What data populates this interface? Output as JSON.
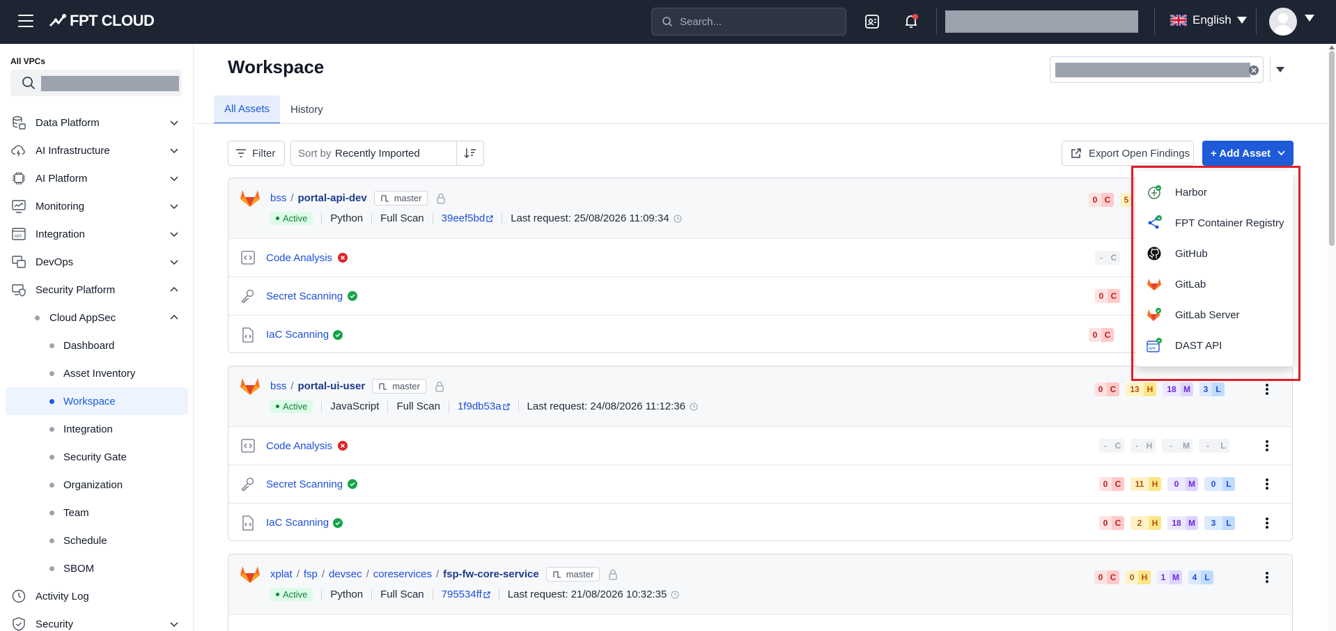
{
  "topbar": {
    "brand": "FPT CLOUD",
    "search_placeholder": "Search...",
    "language": "English"
  },
  "sidebar": {
    "vpc_label": "All VPCs",
    "items": [
      {
        "label": "Data Platform",
        "icon": "database-icon"
      },
      {
        "label": "AI Infrastructure",
        "icon": "cloud-bolt-icon"
      },
      {
        "label": "AI Platform",
        "icon": "chip-icon"
      },
      {
        "label": "Monitoring",
        "icon": "monitor-chart-icon"
      },
      {
        "label": "Integration",
        "icon": "api-icon"
      },
      {
        "label": "DevOps",
        "icon": "devops-icon"
      },
      {
        "label": "Security Platform",
        "icon": "security-platform-icon"
      }
    ],
    "cloud_appsec": "Cloud AppSec",
    "sub_items": [
      "Dashboard",
      "Asset Inventory",
      "Workspace",
      "Integration",
      "Security Gate",
      "Organization",
      "Team",
      "Schedule",
      "SBOM"
    ],
    "bottom_items": [
      "Activity Log",
      "Security"
    ]
  },
  "page": {
    "title": "Workspace",
    "tabs": [
      "All Assets",
      "History"
    ],
    "filter": "Filter",
    "sort_label": "Sort by",
    "sort_value": "Recently Imported",
    "export": "Export Open Findings",
    "add_asset": "+ Add Asset"
  },
  "assets": [
    {
      "path": [
        "bss"
      ],
      "repo": "portal-api-dev",
      "branch": "master",
      "status": "Active",
      "language": "Python",
      "scan_type": "Full Scan",
      "commit": "39eef5bd",
      "last_request": "Last request: 25/08/2026 11:09:34",
      "head_counts": {
        "c": "0",
        "h": "5"
      },
      "scans": [
        {
          "name": "Code Analysis",
          "status": "error",
          "c": "-"
        },
        {
          "name": "Secret Scanning",
          "status": "ok",
          "c": "0"
        },
        {
          "name": "IaC Scanning",
          "status": "ok",
          "c": "0"
        }
      ]
    },
    {
      "path": [
        "bss"
      ],
      "repo": "portal-ui-user",
      "branch": "master",
      "status": "Active",
      "language": "JavaScript",
      "scan_type": "Full Scan",
      "commit": "1f9db53a",
      "last_request": "Last request: 24/08/2026 11:12:36",
      "head_counts": {
        "c": "0",
        "h": "13",
        "m": "18",
        "l": "3"
      },
      "scans": [
        {
          "name": "Code Analysis",
          "status": "error",
          "c": "-",
          "h": "-",
          "m": "-",
          "l": "-"
        },
        {
          "name": "Secret Scanning",
          "status": "ok",
          "c": "0",
          "h": "11",
          "m": "0",
          "l": "0"
        },
        {
          "name": "IaC Scanning",
          "status": "ok",
          "c": "0",
          "h": "2",
          "m": "18",
          "l": "3"
        }
      ]
    },
    {
      "path": [
        "xplat",
        "fsp",
        "devsec",
        "coreservices"
      ],
      "repo": "fsp-fw-core-service",
      "branch": "master",
      "status": "Active",
      "language": "Python",
      "scan_type": "Full Scan",
      "commit": "795534ff",
      "last_request": "Last request: 21/08/2026 10:32:35",
      "head_counts": {
        "c": "0",
        "h": "0",
        "m": "1",
        "l": "4"
      }
    }
  ],
  "severity_letters": {
    "c": "C",
    "h": "H",
    "m": "M",
    "l": "L"
  },
  "path_separator": "/",
  "add_asset_menu": [
    "Harbor",
    "FPT Container Registry",
    "GitHub",
    "GitLab",
    "GitLab Server",
    "DAST API"
  ],
  "colors": {
    "accent": "#1d5bd8",
    "topbar": "#1d2432",
    "highlight": "#e11d2a"
  }
}
